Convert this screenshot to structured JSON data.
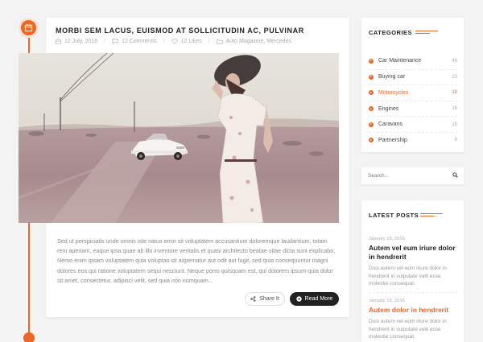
{
  "post": {
    "title": "MORBI SEM LACUS, EUISMOD AT SOLLICITUDIN AC, PULVINAR",
    "meta": {
      "date": "12 July, 2016",
      "comments": "12 Comments",
      "likes": "12 Likes",
      "categories": "Auto Magazine, Mercedes",
      "separator": "/"
    },
    "excerpt": "Sed ut perspiciatis unde omnis iste natus error sit voluptatem accusantium doloremque laudantium, totam rem aperiam, eaque ipsa quae ab illo inventore veritatis et quasi architecto beatae vitae dicta sunt explicabo. Nemo enim ipsam voluptatem quia voluptas sit aspernatur aut odit aut fugit, sed quia consequuntur magni dolores eos qui ratione voluptatem sequi nesciunt. Neque porro quisquam est, qui dolorem ipsum quia dolor sit amet, consectetur, adipisci velit, sed quia non numquam...",
    "share_label": "Share It",
    "readmore_label": "Read More",
    "image_icon": "photo-of-woman-with-hat-and-vintage-car"
  },
  "sidebar": {
    "categories": {
      "title": "CATEGORIES",
      "items": [
        {
          "label": "Car Maintenance",
          "count": "46",
          "active": false
        },
        {
          "label": "Buying car",
          "count": "23",
          "active": false
        },
        {
          "label": "Motorcycles",
          "count": "18",
          "active": true
        },
        {
          "label": "Engines",
          "count": "16",
          "active": false
        },
        {
          "label": "Caravans",
          "count": "15",
          "active": false
        },
        {
          "label": "Partnership",
          "count": "8",
          "active": false
        }
      ]
    },
    "search": {
      "placeholder": "Search..."
    },
    "latest": {
      "title": "LATEST POSTS",
      "items": [
        {
          "date": "January 19, 2016",
          "title": "Autem vel eum iriure dolor in hendrerit",
          "text": "Duis autem vel eum iriure dolor in hendrerit in vulputate velit esse molestie consequat."
        },
        {
          "date": "January 19, 2016",
          "title": "Autem dolor in hendrerit",
          "text": "Duis autem vel eum iriure dolor in hendrerit in vulputate velit esse molestie consequat."
        }
      ]
    }
  },
  "colors": {
    "accent": "#f06424",
    "dark": "#222222",
    "muted": "#aaaaaa"
  },
  "icons": {
    "timeline": "calendar-icon",
    "date": "calendar-icon",
    "comments": "comment-icon",
    "likes": "heart-icon",
    "categories": "folder-icon",
    "share": "share-icon",
    "readmore": "plus-circle-icon",
    "search": "search-icon",
    "category_bullet": "chevron-right-circle-icon"
  }
}
